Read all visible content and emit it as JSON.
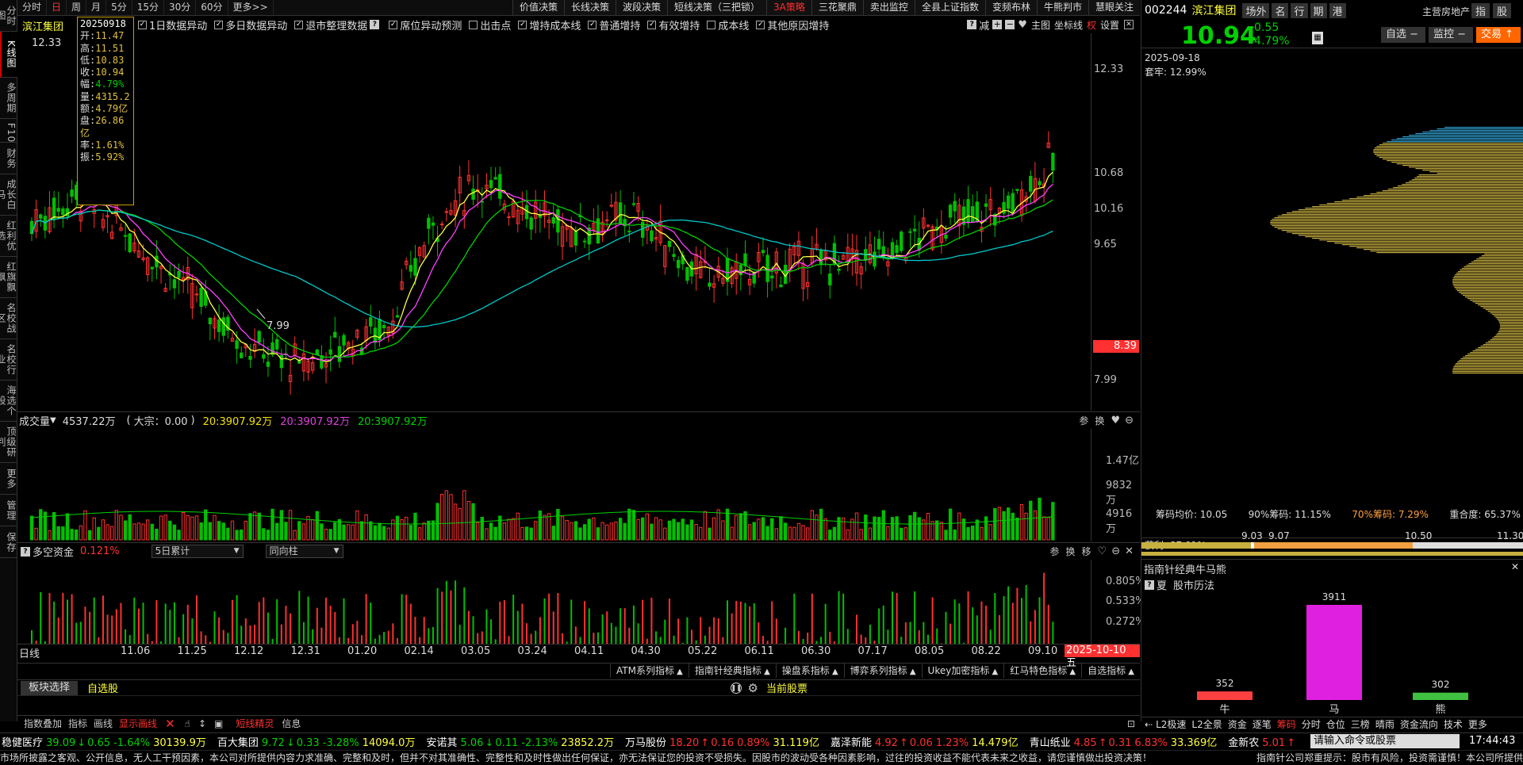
{
  "sidebar": [
    "分时图",
    "K线图",
    "多周期",
    "F10",
    "财务",
    "成长白马",
    "红利优选",
    "红旗飘飘",
    "名校战区",
    "名校行业",
    "海选个股",
    "顶级研判",
    "更多",
    "管理",
    "保存"
  ],
  "periods": [
    "分时",
    "日",
    "周",
    "月",
    "5分",
    "15分",
    "30分",
    "60分",
    "更多>>"
  ],
  "active_period": "日",
  "strategies": [
    "价值决策",
    "长线决策",
    "波段决策",
    "短线决策（三把锁）",
    "3A策略",
    "三花聚鼎",
    "卖出监控",
    "全县上证指数",
    "变频布林",
    "牛熊判市",
    "慧眼关注"
  ],
  "options": [
    {
      "label": "1日数据异动",
      "checked": true
    },
    {
      "label": "多日数据异动",
      "checked": true
    },
    {
      "label": "退市整理数据",
      "checked": true
    },
    {
      "label": "席位异动预测",
      "checked": true
    },
    {
      "label": "出击点",
      "checked": false
    },
    {
      "label": "增持成本线",
      "checked": true
    },
    {
      "label": "普通增持",
      "checked": true
    },
    {
      "label": "有效增持",
      "checked": true
    },
    {
      "label": "成本线",
      "checked": false
    },
    {
      "label": "其他原因增持",
      "checked": true
    }
  ],
  "chart_tools": {
    "reduce": "减",
    "main": "主图",
    "axis": "坐标线",
    "quan": "权",
    "settings": "设置"
  },
  "stock_name": "滨江集团",
  "tooltip": {
    "date": "20250918",
    "open_l": "开:",
    "open": "11.47",
    "high_l": "高:",
    "high": "11.51",
    "low_l": "低:",
    "low": "10.83",
    "close_l": "收:",
    "close": "10.94",
    "chg_l": "幅:",
    "chg": "4.79%",
    "vol_l": "量:",
    "vol": "4315.2",
    "amt_l": "额:",
    "amt": "4.79亿",
    "pan_l": "盘:",
    "pan": "26.86亿",
    "rate_l": "率:",
    "rate": "1.61%",
    "amp_l": "振:",
    "amp": "5.92%"
  },
  "price_axis": [
    "12.33",
    "10.68",
    "10.16",
    "9.65",
    "8.39",
    "7.99"
  ],
  "price_marks": {
    "high": "12.33",
    "low": "7.99",
    "current": "8.39"
  },
  "volume": {
    "title": "成交量",
    "total": "4537.22万",
    "dazong": "大宗：0.00",
    "ma1": "20:3907.92万",
    "ma2": "20:3907.92万",
    "ma3": "20:3907.92万",
    "axis": [
      "1.47亿",
      "9832万",
      "4916万"
    ],
    "tools": [
      "参",
      "换"
    ]
  },
  "duokong": {
    "title": "多空资金",
    "value": "0.121%",
    "select1": "5日累计",
    "select2": "同向柱",
    "axis": [
      "0.805%",
      "0.533%",
      "0.272%"
    ],
    "tools": [
      "参",
      "换",
      "移"
    ]
  },
  "dates": [
    "11.06",
    "11.25",
    "12.12",
    "12.31",
    "01.20",
    "02.14",
    "03.05",
    "03.24",
    "04.11",
    "04.30",
    "05.22",
    "06.11",
    "06.30",
    "07.17",
    "08.05",
    "08.22",
    "09.10"
  ],
  "current_date": "2025-10-10 五",
  "xlabel": "日线",
  "indicator_tabs": [
    "ATM系列指标",
    "指南针经典指标",
    "操盘系指标",
    "博弈系列指标",
    "Ukey加密指标",
    "红马特色指标",
    "自选指标"
  ],
  "sector_tabs": [
    "板块选择",
    "自选股"
  ],
  "current_stock_label": "当前股票",
  "bottom_tools": [
    "指数叠加",
    "指标",
    "画线",
    "显示画线"
  ],
  "bottom_tools2": [
    "短线精灵",
    "信息"
  ],
  "right": {
    "code": "002244",
    "name": "滨江集团",
    "tabs": [
      "场外",
      "名",
      "行",
      "期",
      "港"
    ],
    "industry": "主营房地产",
    "ind_btns": [
      "指",
      "股"
    ],
    "price": "10.94",
    "change": "-0.55",
    "pct": "-4.79%",
    "btn_zixuan": "自选",
    "btn_jiankong": "监控",
    "btn_trade": "交易",
    "date": "2025-09-18",
    "taolao": "套牢: 12.99%",
    "chip_stats": {
      "avg": "筹码均价: 10.05",
      "p90": "90%筹码: 11.15%",
      "p70": "70%筹码: 7.29%",
      "overlap": "重合度: 65.37%"
    },
    "profit": "获利: 87.01%",
    "range": [
      "9.03",
      "9.07",
      "10.50",
      "11.30"
    ],
    "bullbear_title": "指南针经典牛马熊",
    "season": "夏",
    "history": "股市历法",
    "bars": [
      {
        "label": "牛",
        "value": 352,
        "color": "#ff4040"
      },
      {
        "label": "马",
        "value": 3911,
        "color": "#e020e0"
      },
      {
        "label": "熊",
        "value": 302,
        "color": "#40c040"
      }
    ],
    "bottom_tabs": [
      "L2极速",
      "L2全景",
      "资金",
      "逐笔",
      "筹码",
      "分时",
      "仓位",
      "三榜",
      "晴雨",
      "资金流向",
      "技术",
      "更多"
    ],
    "active_bottom_tab": "筹码"
  },
  "ticker": [
    {
      "name": "稳健医疗",
      "price": "39.09",
      "dir": "↓",
      "chg": "0.65",
      "pct": "-1.64%",
      "amt": "30139.9万",
      "up": false
    },
    {
      "name": "百大集团",
      "price": "9.72",
      "dir": "↓",
      "chg": "0.33",
      "pct": "-3.28%",
      "amt": "14094.0万",
      "up": false
    },
    {
      "name": "安诺其",
      "price": "5.06",
      "dir": "↓",
      "chg": "0.11",
      "pct": "-2.13%",
      "amt": "23852.2万",
      "up": false
    },
    {
      "name": "万马股份",
      "price": "18.20",
      "dir": "↑",
      "chg": "0.16",
      "pct": "0.89%",
      "amt": "31.119亿",
      "up": true
    },
    {
      "name": "嘉泽新能",
      "price": "4.92",
      "dir": "↑",
      "chg": "0.06",
      "pct": "1.23%",
      "amt": "14.479亿",
      "up": true
    },
    {
      "name": "青山纸业",
      "price": "4.85",
      "dir": "↑",
      "chg": "0.31",
      "pct": "6.83%",
      "amt": "33.369亿",
      "up": true
    },
    {
      "name": "金新农",
      "price": "5.01",
      "dir": "↑",
      "chg": "",
      "pct": "",
      "amt": "",
      "up": true
    }
  ],
  "command_placeholder": "请输入命令或股票",
  "clock": "17:44:43",
  "disclaimer": "市场所披露之客观、公开信息，无人工干预因素，本公司对所提供内容力求准确、完整和及时，但并不对其准确性、完整性和及时性做出任何保证，亦无法保证您的投资不受损失。因股市的波动受各种因素影响，过往的投资收益不能代表未来之收益，请您谨慎做出投资决策！",
  "disclaimer_right": "指南针公司郑重提示：股市有风险，投资需谨慎！本公司所提供",
  "colors": {
    "up": "#ff3030",
    "down": "#00c000",
    "ma5": "#ffff40",
    "ma10": "#ff40ff",
    "ma20": "#00d000",
    "ma60": "#00c8c8"
  }
}
